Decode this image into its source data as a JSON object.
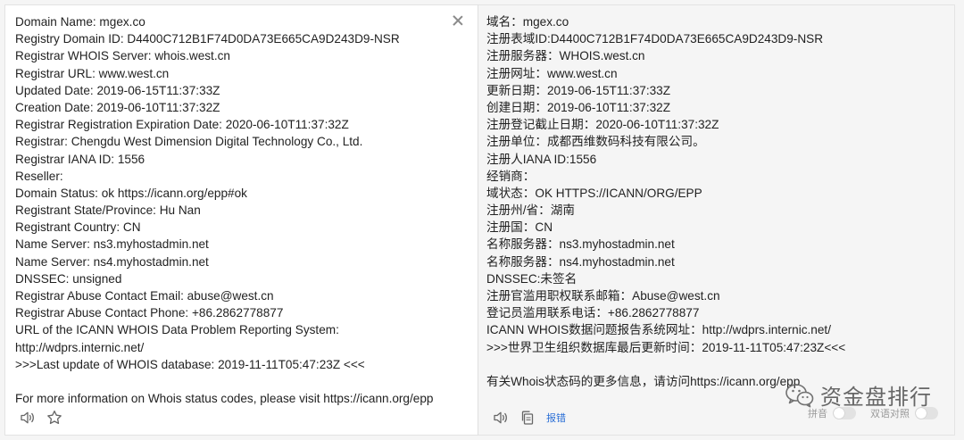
{
  "left_pane": {
    "lines": [
      "Domain Name: mgex.co",
      "Registry Domain ID: D4400C712B1F74D0DA73E665CA9D243D9-NSR",
      "Registrar WHOIS Server: whois.west.cn",
      "Registrar URL: www.west.cn",
      "Updated Date: 2019-06-15T11:37:33Z",
      "Creation Date: 2019-06-10T11:37:32Z",
      "Registrar Registration Expiration Date: 2020-06-10T11:37:32Z",
      "Registrar: Chengdu West Dimension Digital Technology Co., Ltd.",
      "Registrar IANA ID: 1556",
      "Reseller:",
      "Domain Status: ok https://icann.org/epp#ok",
      "Registrant State/Province: Hu Nan",
      "Registrant Country: CN",
      "Name Server: ns3.myhostadmin.net",
      "Name Server: ns4.myhostadmin.net",
      "DNSSEC: unsigned",
      "Registrar Abuse Contact Email: abuse@west.cn",
      "Registrar Abuse Contact Phone: +86.2862778877",
      "URL of the ICANN WHOIS Data Problem Reporting System:",
      "http://wdprs.internic.net/",
      ">>>Last update of WHOIS database: 2019-11-11T05:47:23Z <<<",
      "",
      "For more information on Whois status codes, please visit https://icann.org/epp"
    ],
    "icons": {
      "close": "close-icon",
      "speaker": "speaker-icon",
      "star": "star-icon"
    }
  },
  "right_pane": {
    "lines": [
      "域名：mgex.co",
      "注册表域ID:D4400C712B1F74D0DA73E665CA9D243D9-NSR",
      "注册服务器：WHOIS.west.cn",
      "注册网址：www.west.cn",
      "更新日期：2019-06-15T11:37:33Z",
      "创建日期：2019-06-10T11:37:32Z",
      "注册登记截止日期：2020-06-10T11:37:32Z",
      "注册单位：成都西维数码科技有限公司。",
      "注册人IANA ID:1556",
      "经销商：",
      "域状态：OK HTTPS://ICANN/ORG/EPP",
      "注册州/省：湖南",
      "注册国：CN",
      "名称服务器：ns3.myhostadmin.net",
      "名称服务器：ns4.myhostadmin.net",
      "DNSSEC:未签名",
      "注册官滥用职权联系邮箱：Abuse@west.cn",
      "登记员滥用联系电话：+86.2862778877",
      "ICANN WHOIS数据问题报告系统网址：http://wdprs.internic.net/",
      ">>>世界卫生组织数据库最后更新时间：2019-11-11T05:47:23Z<<<",
      "",
      "有关Whois状态码的更多信息，请访问https://icann.org/epp"
    ],
    "toolbar": {
      "report_label": "报错"
    },
    "toggles": {
      "pinyin_label": "拼音",
      "bilingual_label": "双语对照"
    },
    "icons": {
      "speaker": "speaker-icon",
      "copy": "copy-icon"
    }
  },
  "watermark": {
    "text": "资金盘排行",
    "icon": "wechat-icon"
  },
  "colors": {
    "link": "#2b6fd6",
    "text": "#222222",
    "muted": "#9a9a9a",
    "left_bg": "#ffffff",
    "right_bg": "#f5f5f5"
  }
}
